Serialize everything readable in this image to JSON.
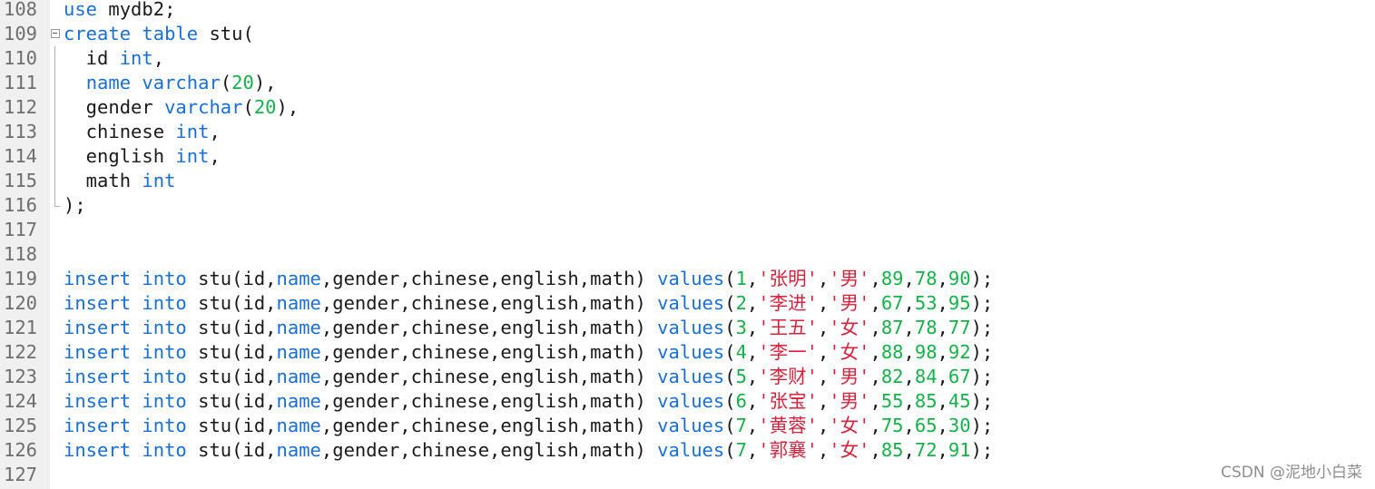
{
  "editor": {
    "lines": [
      {
        "no": "108",
        "fold": "",
        "tokens": [
          [
            "kw",
            "use"
          ],
          [
            "id",
            " mydb2;"
          ]
        ]
      },
      {
        "no": "109",
        "fold": "box",
        "tokens": [
          [
            "kw",
            "create"
          ],
          [
            "id",
            " "
          ],
          [
            "kw",
            "table"
          ],
          [
            "id",
            " stu("
          ]
        ]
      },
      {
        "no": "110",
        "fold": "vline",
        "tokens": [
          [
            "id",
            "  id "
          ],
          [
            "kw",
            "int"
          ],
          [
            "id",
            ","
          ]
        ]
      },
      {
        "no": "111",
        "fold": "vline",
        "tokens": [
          [
            "id",
            "  "
          ],
          [
            "kw",
            "name"
          ],
          [
            "id",
            " "
          ],
          [
            "kw",
            "varchar"
          ],
          [
            "id",
            "("
          ],
          [
            "num",
            "20"
          ],
          [
            "id",
            "),"
          ]
        ]
      },
      {
        "no": "112",
        "fold": "vline",
        "tokens": [
          [
            "id",
            "  gender "
          ],
          [
            "kw",
            "varchar"
          ],
          [
            "id",
            "("
          ],
          [
            "num",
            "20"
          ],
          [
            "id",
            "),"
          ]
        ]
      },
      {
        "no": "113",
        "fold": "vline",
        "tokens": [
          [
            "id",
            "  chinese "
          ],
          [
            "kw",
            "int"
          ],
          [
            "id",
            ","
          ]
        ]
      },
      {
        "no": "114",
        "fold": "vline",
        "tokens": [
          [
            "id",
            "  english "
          ],
          [
            "kw",
            "int"
          ],
          [
            "id",
            ","
          ]
        ]
      },
      {
        "no": "115",
        "fold": "vline",
        "tokens": [
          [
            "id",
            "  math "
          ],
          [
            "kw",
            "int"
          ]
        ]
      },
      {
        "no": "116",
        "fold": "end",
        "tokens": [
          [
            "id",
            ");"
          ]
        ]
      },
      {
        "no": "117",
        "fold": "",
        "tokens": []
      },
      {
        "no": "118",
        "fold": "",
        "tokens": []
      },
      {
        "no": "119",
        "fold": "",
        "tokens": [
          [
            "kw",
            "insert"
          ],
          [
            "id",
            " "
          ],
          [
            "kw",
            "into"
          ],
          [
            "id",
            " stu(id,"
          ],
          [
            "kw",
            "name"
          ],
          [
            "id",
            ",gender,chinese,english,math) "
          ],
          [
            "kw",
            "values"
          ],
          [
            "id",
            "("
          ],
          [
            "num",
            "1"
          ],
          [
            "id",
            ","
          ],
          [
            "str",
            "'张明'"
          ],
          [
            "id",
            ","
          ],
          [
            "str",
            "'男'"
          ],
          [
            "id",
            ","
          ],
          [
            "num",
            "89"
          ],
          [
            "id",
            ","
          ],
          [
            "num",
            "78"
          ],
          [
            "id",
            ","
          ],
          [
            "num",
            "90"
          ],
          [
            "id",
            ");"
          ]
        ]
      },
      {
        "no": "120",
        "fold": "",
        "tokens": [
          [
            "kw",
            "insert"
          ],
          [
            "id",
            " "
          ],
          [
            "kw",
            "into"
          ],
          [
            "id",
            " stu(id,"
          ],
          [
            "kw",
            "name"
          ],
          [
            "id",
            ",gender,chinese,english,math) "
          ],
          [
            "kw",
            "values"
          ],
          [
            "id",
            "("
          ],
          [
            "num",
            "2"
          ],
          [
            "id",
            ","
          ],
          [
            "str",
            "'李进'"
          ],
          [
            "id",
            ","
          ],
          [
            "str",
            "'男'"
          ],
          [
            "id",
            ","
          ],
          [
            "num",
            "67"
          ],
          [
            "id",
            ","
          ],
          [
            "num",
            "53"
          ],
          [
            "id",
            ","
          ],
          [
            "num",
            "95"
          ],
          [
            "id",
            ");"
          ]
        ]
      },
      {
        "no": "121",
        "fold": "",
        "tokens": [
          [
            "kw",
            "insert"
          ],
          [
            "id",
            " "
          ],
          [
            "kw",
            "into"
          ],
          [
            "id",
            " stu(id,"
          ],
          [
            "kw",
            "name"
          ],
          [
            "id",
            ",gender,chinese,english,math) "
          ],
          [
            "kw",
            "values"
          ],
          [
            "id",
            "("
          ],
          [
            "num",
            "3"
          ],
          [
            "id",
            ","
          ],
          [
            "str",
            "'王五'"
          ],
          [
            "id",
            ","
          ],
          [
            "str",
            "'女'"
          ],
          [
            "id",
            ","
          ],
          [
            "num",
            "87"
          ],
          [
            "id",
            ","
          ],
          [
            "num",
            "78"
          ],
          [
            "id",
            ","
          ],
          [
            "num",
            "77"
          ],
          [
            "id",
            ");"
          ]
        ]
      },
      {
        "no": "122",
        "fold": "",
        "tokens": [
          [
            "kw",
            "insert"
          ],
          [
            "id",
            " "
          ],
          [
            "kw",
            "into"
          ],
          [
            "id",
            " stu(id,"
          ],
          [
            "kw",
            "name"
          ],
          [
            "id",
            ",gender,chinese,english,math) "
          ],
          [
            "kw",
            "values"
          ],
          [
            "id",
            "("
          ],
          [
            "num",
            "4"
          ],
          [
            "id",
            ","
          ],
          [
            "str",
            "'李一'"
          ],
          [
            "id",
            ","
          ],
          [
            "str",
            "'女'"
          ],
          [
            "id",
            ","
          ],
          [
            "num",
            "88"
          ],
          [
            "id",
            ","
          ],
          [
            "num",
            "98"
          ],
          [
            "id",
            ","
          ],
          [
            "num",
            "92"
          ],
          [
            "id",
            ");"
          ]
        ]
      },
      {
        "no": "123",
        "fold": "",
        "tokens": [
          [
            "kw",
            "insert"
          ],
          [
            "id",
            " "
          ],
          [
            "kw",
            "into"
          ],
          [
            "id",
            " stu(id,"
          ],
          [
            "kw",
            "name"
          ],
          [
            "id",
            ",gender,chinese,english,math) "
          ],
          [
            "kw",
            "values"
          ],
          [
            "id",
            "("
          ],
          [
            "num",
            "5"
          ],
          [
            "id",
            ","
          ],
          [
            "str",
            "'李财'"
          ],
          [
            "id",
            ","
          ],
          [
            "str",
            "'男'"
          ],
          [
            "id",
            ","
          ],
          [
            "num",
            "82"
          ],
          [
            "id",
            ","
          ],
          [
            "num",
            "84"
          ],
          [
            "id",
            ","
          ],
          [
            "num",
            "67"
          ],
          [
            "id",
            ");"
          ]
        ]
      },
      {
        "no": "124",
        "fold": "",
        "tokens": [
          [
            "kw",
            "insert"
          ],
          [
            "id",
            " "
          ],
          [
            "kw",
            "into"
          ],
          [
            "id",
            " stu(id,"
          ],
          [
            "kw",
            "name"
          ],
          [
            "id",
            ",gender,chinese,english,math) "
          ],
          [
            "kw",
            "values"
          ],
          [
            "id",
            "("
          ],
          [
            "num",
            "6"
          ],
          [
            "id",
            ","
          ],
          [
            "str",
            "'张宝'"
          ],
          [
            "id",
            ","
          ],
          [
            "str",
            "'男'"
          ],
          [
            "id",
            ","
          ],
          [
            "num",
            "55"
          ],
          [
            "id",
            ","
          ],
          [
            "num",
            "85"
          ],
          [
            "id",
            ","
          ],
          [
            "num",
            "45"
          ],
          [
            "id",
            ");"
          ]
        ]
      },
      {
        "no": "125",
        "fold": "",
        "tokens": [
          [
            "kw",
            "insert"
          ],
          [
            "id",
            " "
          ],
          [
            "kw",
            "into"
          ],
          [
            "id",
            " stu(id,"
          ],
          [
            "kw",
            "name"
          ],
          [
            "id",
            ",gender,chinese,english,math) "
          ],
          [
            "kw",
            "values"
          ],
          [
            "id",
            "("
          ],
          [
            "num",
            "7"
          ],
          [
            "id",
            ","
          ],
          [
            "str",
            "'黄蓉'"
          ],
          [
            "id",
            ","
          ],
          [
            "str",
            "'女'"
          ],
          [
            "id",
            ","
          ],
          [
            "num",
            "75"
          ],
          [
            "id",
            ","
          ],
          [
            "num",
            "65"
          ],
          [
            "id",
            ","
          ],
          [
            "num",
            "30"
          ],
          [
            "id",
            ");"
          ]
        ]
      },
      {
        "no": "126",
        "fold": "",
        "tokens": [
          [
            "kw",
            "insert"
          ],
          [
            "id",
            " "
          ],
          [
            "kw",
            "into"
          ],
          [
            "id",
            " stu(id,"
          ],
          [
            "kw",
            "name"
          ],
          [
            "id",
            ",gender,chinese,english,math) "
          ],
          [
            "kw",
            "values"
          ],
          [
            "id",
            "("
          ],
          [
            "num",
            "7"
          ],
          [
            "id",
            ","
          ],
          [
            "str",
            "'郭襄'"
          ],
          [
            "id",
            ","
          ],
          [
            "str",
            "'女'"
          ],
          [
            "id",
            ","
          ],
          [
            "num",
            "85"
          ],
          [
            "id",
            ","
          ],
          [
            "num",
            "72"
          ],
          [
            "id",
            ","
          ],
          [
            "num",
            "91"
          ],
          [
            "id",
            ");"
          ]
        ]
      },
      {
        "no": "127",
        "fold": "",
        "tokens": []
      }
    ]
  },
  "colors": {
    "keyword": "#1a6fd6",
    "number": "#14b24a",
    "string": "#d8233e",
    "text": "#1a1a1a",
    "line_number": "#6e6e6e",
    "gutter_bg": "#f0f0f0"
  },
  "watermark": "CSDN @泥地小白菜"
}
